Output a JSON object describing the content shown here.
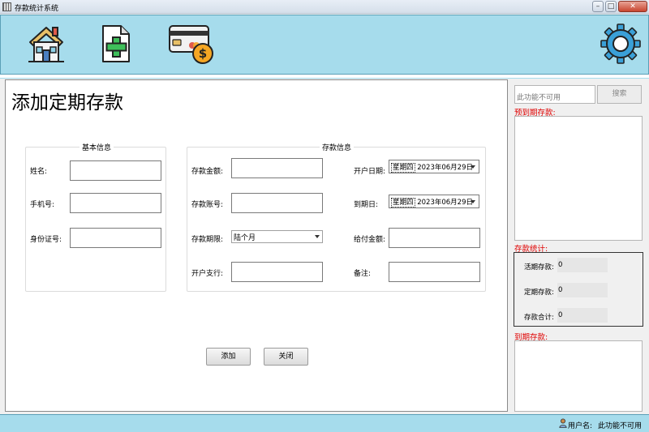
{
  "window": {
    "title": "存款统计系统",
    "minimize_glyph": "–",
    "maximize_glyph": "□",
    "close_glyph": "✕"
  },
  "toolbar": {
    "icons": [
      "home-icon",
      "add-document-icon",
      "card-payment-icon",
      "settings-gear-icon"
    ]
  },
  "page": {
    "heading": "添加定期存款"
  },
  "basic_info": {
    "title": "基本信息",
    "name_label": "姓名:",
    "name_value": "",
    "phone_label": "手机号:",
    "phone_value": "",
    "id_label": "身份证号:",
    "id_value": ""
  },
  "deposit_info": {
    "title": "存款信息",
    "amount_label": "存款金额:",
    "amount_value": "",
    "account_label": "存款账号:",
    "account_value": "",
    "term_label": "存款期限:",
    "term_value": "陆个月",
    "branch_label": "开户支行:",
    "branch_value": "",
    "open_date_label": "开户日期:",
    "open_date_weekday": "星期四",
    "open_date_value": "2023年06月29日",
    "due_date_label": "到期日:",
    "due_date_weekday": "星期四",
    "due_date_value": "2023年06月29日",
    "payout_label": "给付金额:",
    "payout_value": "",
    "note_label": "备注:",
    "note_value": ""
  },
  "actions": {
    "add_label": "添加",
    "close_label": "关闭"
  },
  "sidebar": {
    "search_placeholder": "此功能不可用",
    "search_button": "搜索",
    "upcoming_label": "预到期存款:",
    "stats_label": "存款统计:",
    "demand_label": "活期存款:",
    "demand_value": "0",
    "fixed_label": "定期存款:",
    "fixed_value": "0",
    "total_label": "存款合计:",
    "total_value": "0",
    "matured_label": "到期存款:"
  },
  "status": {
    "user_label": "用户名:",
    "user_value": "此功能不可用"
  },
  "colors": {
    "toolbar_bg": "#a6dcec",
    "alert_red": "#e00000",
    "house_roof": "#e8c067",
    "plus_green": "#3fbf5a",
    "coin_orange": "#f5a623"
  }
}
